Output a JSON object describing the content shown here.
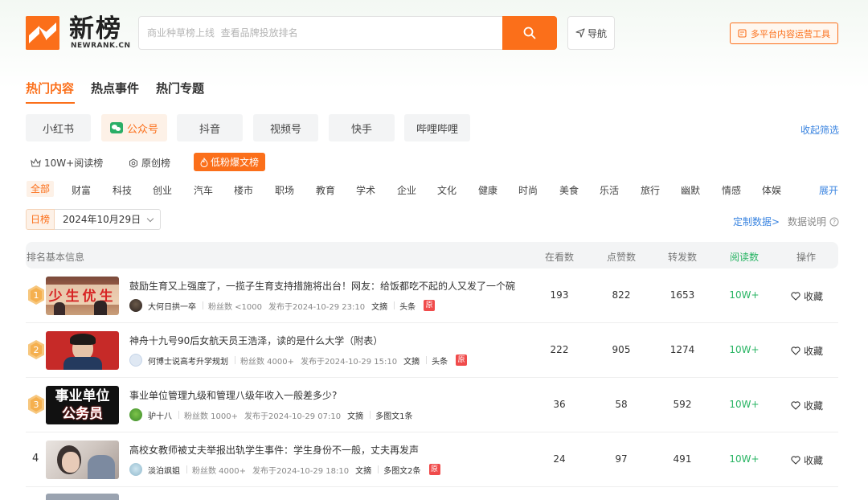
{
  "header": {
    "logo_name": "新榜",
    "logo_sub": "NEWRANK.CN",
    "search_placeholder": "商业种草榜上线  查看品牌投放排名",
    "nav_label": "导航",
    "tool_label": "多平台内容运营工具"
  },
  "main_tabs": [
    "热门内容",
    "热点事件",
    "热门专题"
  ],
  "platforms": [
    "小红书",
    "公众号",
    "抖音",
    "视频号",
    "快手",
    "哔哩哔哩"
  ],
  "collapse_label": "收起筛选",
  "rank_types": [
    "10W+阅读榜",
    "原创榜",
    "低粉爆文榜"
  ],
  "categories": [
    "全部",
    "财富",
    "科技",
    "创业",
    "汽车",
    "楼市",
    "职场",
    "教育",
    "学术",
    "企业",
    "文化",
    "健康",
    "时尚",
    "美食",
    "乐活",
    "旅行",
    "幽默",
    "情感",
    "体娱"
  ],
  "expand_label": "展开",
  "date_tag": "日榜",
  "date_value": "2024年10月29日",
  "custom_data": "定制数据>",
  "data_desc": "数据说明",
  "table_headers": {
    "info": "排名基本信息",
    "views": "在看数",
    "likes": "点赞数",
    "shares": "转发数",
    "reads": "阅读数",
    "action": "操作"
  },
  "thumb_texts": {
    "row1": "少生优生",
    "row3_line1": "事业单位",
    "row3_line2": "公务员"
  },
  "rows": [
    {
      "rank": "1",
      "title": "鼓励生育又上强度了，一揽子生育支持措施将出台！网友：给饭都吃不起的人又发了一个碗",
      "author": "大何日拱一卒",
      "fans": "粉丝数 <1000",
      "time": "发布于2024-10-29 23:10",
      "type": "文摘",
      "pos": "头条",
      "orig": "原",
      "views": "193",
      "likes": "822",
      "shares": "1653",
      "reads": "10W+",
      "fav": "收藏"
    },
    {
      "rank": "2",
      "title": "神舟十九号90后女航天员王浩泽，读的是什么大学（附表）",
      "author": "何博士说高考升学规划",
      "fans": "粉丝数 4000+",
      "time": "发布于2024-10-29 15:10",
      "type": "文摘",
      "pos": "头条",
      "orig": "原",
      "views": "222",
      "likes": "905",
      "shares": "1274",
      "reads": "10W+",
      "fav": "收藏"
    },
    {
      "rank": "3",
      "title": "事业单位管理九级和管理八级年收入一般差多少?",
      "author": "驴十八",
      "fans": "粉丝数 1000+",
      "time": "发布于2024-10-29 07:10",
      "type": "文摘",
      "pos": "多图文1条",
      "orig": "",
      "views": "36",
      "likes": "58",
      "shares": "592",
      "reads": "10W+",
      "fav": "收藏"
    },
    {
      "rank": "4",
      "title": "高校女教师被丈夫举报出轨学生事件：学生身份不一般，丈夫再发声",
      "author": "淡泊飒姐",
      "fans": "粉丝数 4000+",
      "time": "发布于2024-10-29 18:10",
      "type": "文摘",
      "pos": "多图文2条",
      "orig": "原",
      "views": "24",
      "likes": "97",
      "shares": "491",
      "reads": "10W+",
      "fav": "收藏"
    }
  ],
  "colors": {
    "accent": "#fb6f1a",
    "green": "#28b463",
    "blue": "#3a84e0"
  }
}
